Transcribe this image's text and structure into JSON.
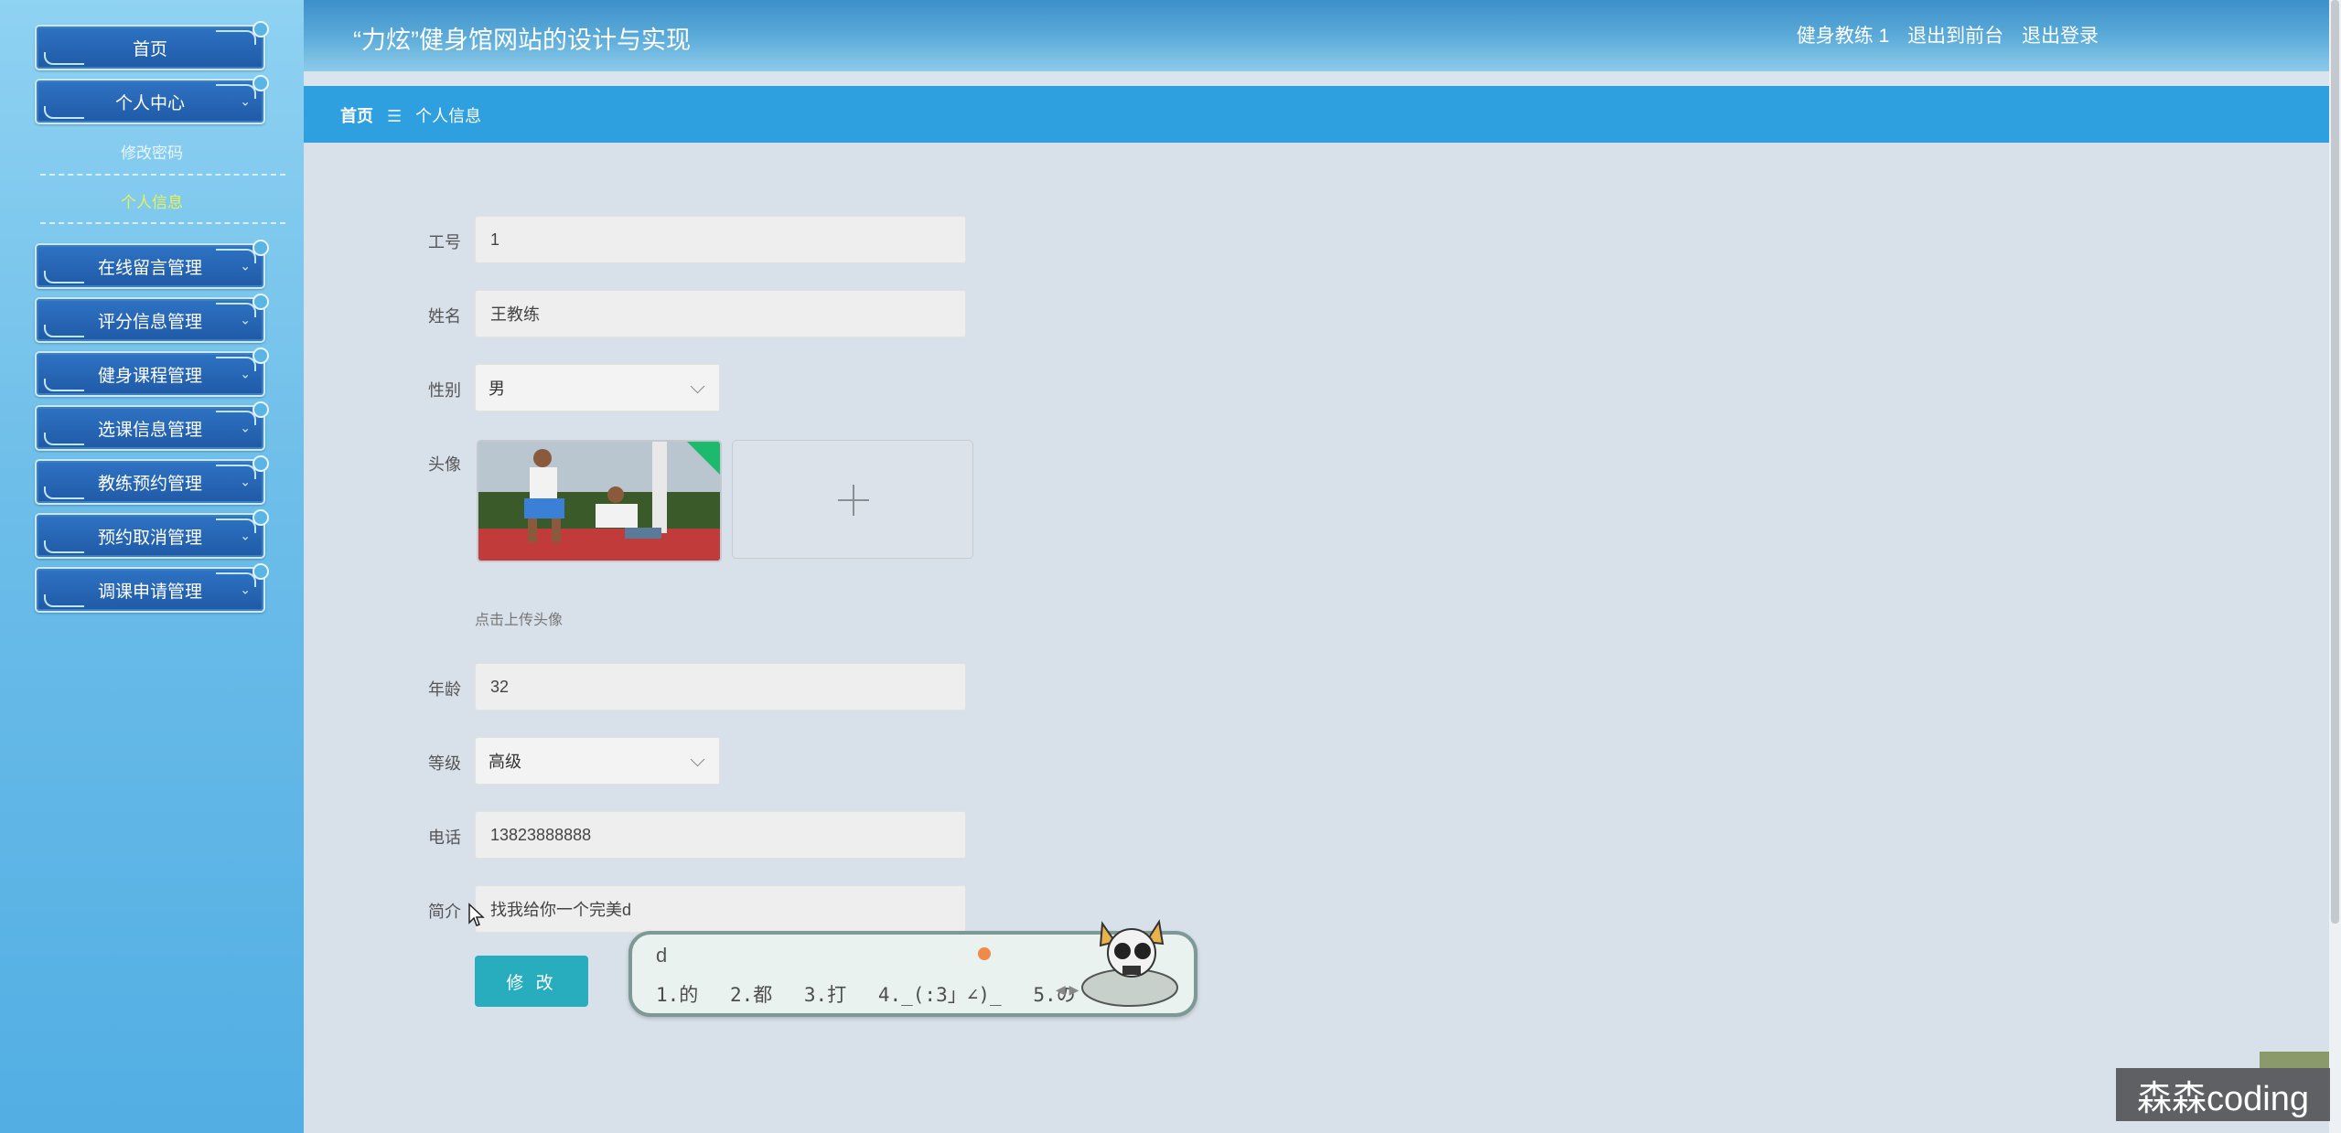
{
  "header": {
    "title": "“力炫”健身馆网站的设计与实现",
    "user": "健身教练 1",
    "links": [
      "退出到前台",
      "退出登录"
    ]
  },
  "breadcrumb": {
    "home": "首页",
    "separator": "☰",
    "current": "个人信息"
  },
  "sidebar": {
    "top": [
      "首页",
      "个人中心"
    ],
    "submenu": [
      "修改密码",
      "个人信息"
    ],
    "active_submenu": "个人信息",
    "items": [
      "在线留言管理",
      "评分信息管理",
      "健身课程管理",
      "选课信息管理",
      "教练预约管理",
      "预约取消管理",
      "调课申请管理"
    ]
  },
  "form": {
    "fields": {
      "gonghao": {
        "label": "工号",
        "value": "1"
      },
      "name": {
        "label": "姓名",
        "value": "王教练"
      },
      "gender": {
        "label": "性别",
        "value": "男"
      },
      "avatar": {
        "label": "头像",
        "hint": "点击上传头像"
      },
      "age": {
        "label": "年龄",
        "value": "32"
      },
      "level": {
        "label": "等级",
        "value": "高级"
      },
      "phone": {
        "label": "电话",
        "value": "13823888888"
      },
      "intro": {
        "label": "简介",
        "value": "找我给你一个完美d"
      }
    },
    "submit": "修 改"
  },
  "ime": {
    "composition": "d",
    "candidates": [
      "1.的",
      "2.都",
      "3.打",
      "4._(:3」∠)_",
      "5.の"
    ]
  },
  "watermark": "森森coding",
  "colors": {
    "accent": "#2e9fdf",
    "submit": "#27adbd",
    "sidebar_button": "#1f5aa6",
    "active_submenu": "#e6f25a"
  }
}
